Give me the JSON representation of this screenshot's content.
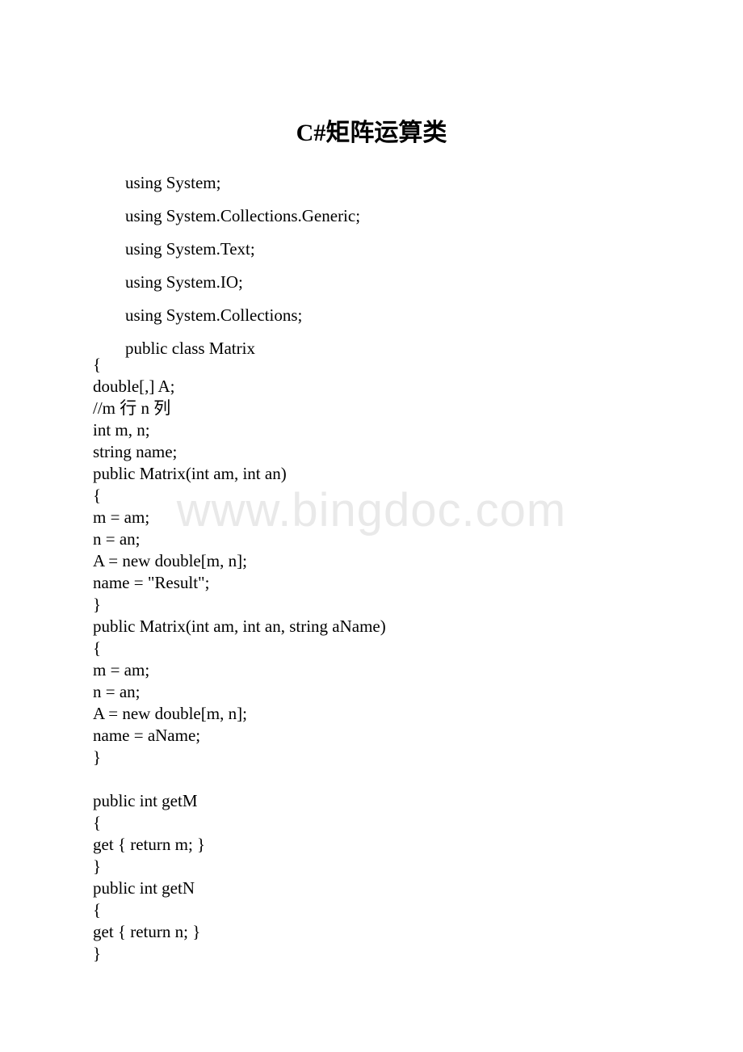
{
  "document": {
    "title": "C#矩阵运算类",
    "watermark": "www.bingdoc.com"
  },
  "blocks": {
    "imports": [
      "using System;",
      "using System.Collections.Generic;",
      "using System.Text;",
      "using System.IO;",
      "using System.Collections;",
      "public class Matrix"
    ],
    "body": [
      "{",
      "double[,] A;",
      "//m 行 n 列",
      "int m, n;",
      "string name;",
      "public Matrix(int am, int an)",
      "{",
      "m = am;",
      "n = an;",
      "A = new double[m, n];",
      "name = \"Result\";",
      "}",
      "public Matrix(int am, int an, string aName)",
      "{",
      "m = am;",
      "n = an;",
      "A = new double[m, n];",
      "name = aName;",
      "}",
      "",
      "public int getM",
      "{",
      "get { return m; }",
      "}",
      "public int getN",
      "{",
      "get { return n; }",
      "}"
    ]
  },
  "colors": {
    "text": "#000000",
    "page_background": "#ffffff",
    "watermark": "#e9e9e9"
  }
}
